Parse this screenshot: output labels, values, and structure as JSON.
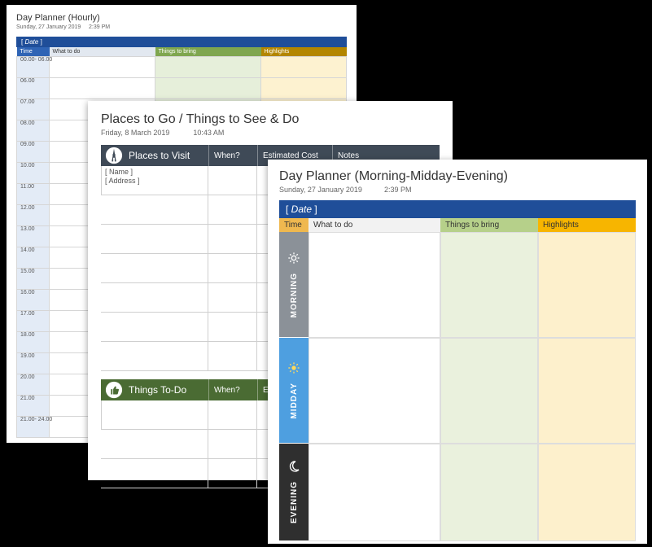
{
  "hourly": {
    "title": "Day Planner (Hourly)",
    "date": "Sunday, 27 January 2019",
    "time": "2:39 PM",
    "dateLabel": "Date",
    "cols": {
      "time": "Time",
      "what": "What to do",
      "bring": "Things to bring",
      "high": "Highlights"
    },
    "rows": [
      "00.00- 06.00",
      "06.00",
      "07.00",
      "08.00",
      "09.00",
      "10.00",
      "11.00",
      "12.00",
      "13.00",
      "14.00",
      "15.00",
      "16.00",
      "17.00",
      "18.00",
      "19.00",
      "20.00",
      "21.00",
      "21.00- 24.00"
    ]
  },
  "places": {
    "title": "Places to Go / Things to See & Do",
    "date": "Friday, 8 March 2019",
    "time": "10:43 AM",
    "visit": {
      "title": "Places to Visit",
      "cols": {
        "when": "When?",
        "cost": "Estimated Cost",
        "notes": "Notes"
      },
      "firstName": "[ Name ]",
      "firstAddr": "[ Address ]",
      "rows": 7
    },
    "todo": {
      "title": "Things To-Do",
      "cols": {
        "when": "When?",
        "cost": "Estim"
      },
      "rows": 3
    }
  },
  "mme": {
    "title": "Day Planner (Morning-Midday-Evening)",
    "date": "Sunday, 27 January 2019",
    "time": "2:39 PM",
    "dateLabel": "Date",
    "cols": {
      "time": "Time",
      "what": "What to do",
      "bring": "Things to bring",
      "high": "Highlights"
    },
    "sections": {
      "morning": "MORNING",
      "midday": "MIDDAY",
      "evening": "EVENING"
    }
  }
}
